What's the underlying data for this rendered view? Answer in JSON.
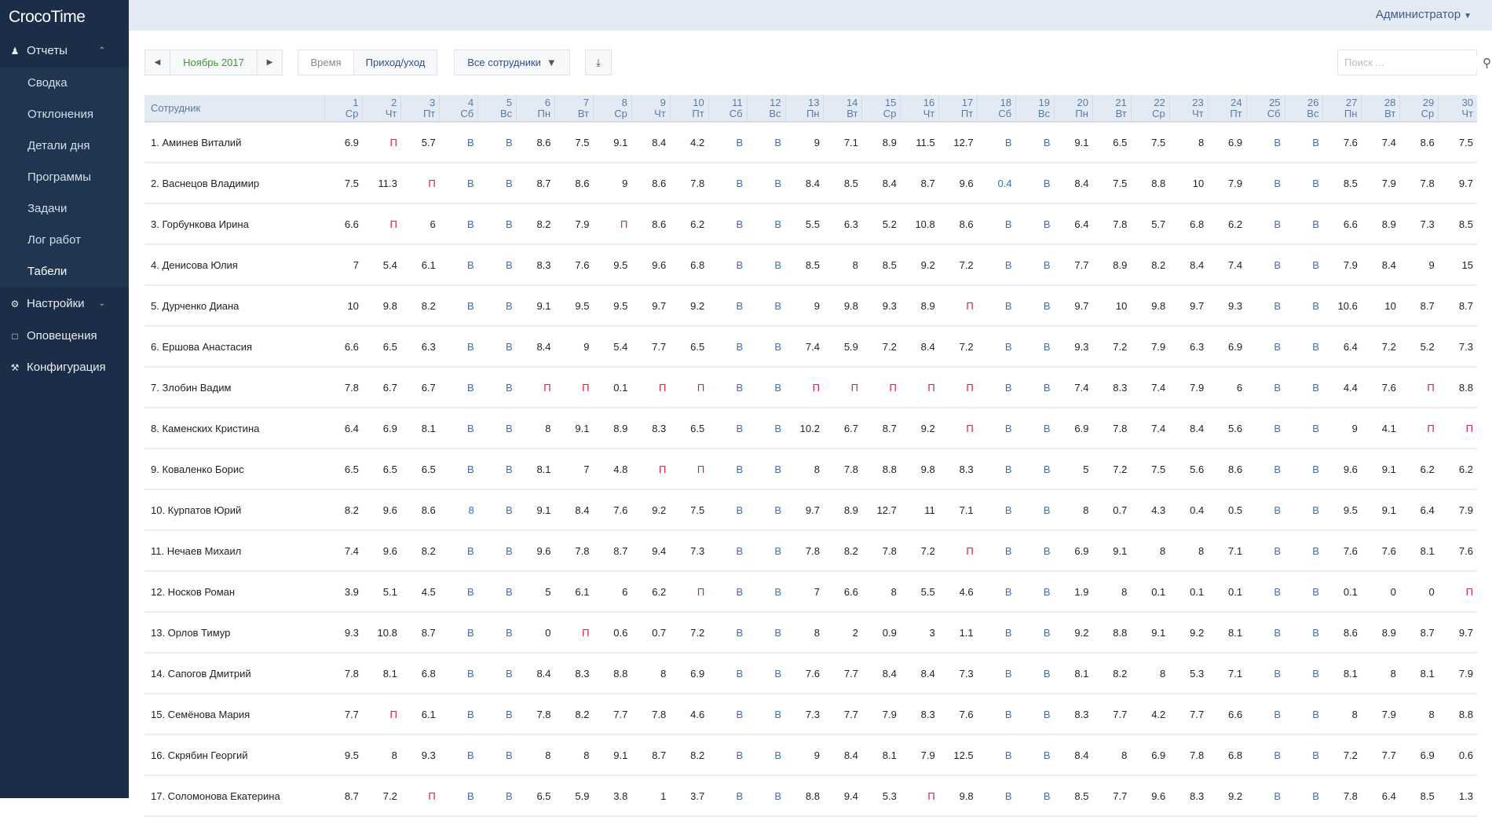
{
  "app": {
    "title": "CrocoTime"
  },
  "sidebar": {
    "reports": {
      "label": "Отчеты",
      "items": [
        "Сводка",
        "Отклонения",
        "Детали дня",
        "Программы",
        "Задачи",
        "Лог работ",
        "Табели"
      ],
      "active": "Табели"
    },
    "settings": "Настройки",
    "notifications": "Оповещения",
    "config": "Конфигурация"
  },
  "header": {
    "user": "Администратор"
  },
  "toolbar": {
    "month": "Ноябрь 2017",
    "mode_time": "Время",
    "mode_inout": "Приход/уход",
    "employees_filter": "Все сотрудники",
    "search_placeholder": "Поиск ..."
  },
  "colors": {
    "weekend": "#2f6fd0",
    "absence": "#e8163a",
    "month": "#3c9a2a",
    "sidebar": "#1c2e47"
  },
  "table": {
    "name_header": "Сотрудник",
    "weekdays": [
      "Ср",
      "Чт",
      "Пт",
      "Сб",
      "Вс",
      "Пн",
      "Вт",
      "Ср",
      "Чт",
      "Пт",
      "Сб",
      "Вс",
      "Пн",
      "Вт",
      "Ср",
      "Чт",
      "Пт",
      "Сб",
      "Вс",
      "Пн",
      "Вт",
      "Ср",
      "Чт",
      "Пт",
      "Сб",
      "Вс",
      "Пн",
      "Вт",
      "Ср",
      "Чт"
    ],
    "rows": [
      {
        "name": "1. Аминев Виталий",
        "v": [
          "6.9",
          "П",
          "5.7",
          "В",
          "В",
          "8.6",
          "7.5",
          "9.1",
          "8.4",
          "4.2",
          "В",
          "В",
          "9",
          "7.1",
          "8.9",
          "11.5",
          "12.7",
          "В",
          "В",
          "9.1",
          "6.5",
          "7.5",
          "8",
          "6.9",
          "В",
          "В",
          "7.6",
          "7.4",
          "8.6",
          "7.5"
        ]
      },
      {
        "name": "2. Васнецов Владимир",
        "v": [
          "7.5",
          "11.3",
          "П",
          "В",
          "В",
          "8.7",
          "8.6",
          "9",
          "8.6",
          "7.8",
          "В",
          "В",
          "8.4",
          "8.5",
          "8.4",
          "8.7",
          "9.6",
          "0.4",
          "В",
          "8.4",
          "7.5",
          "8.8",
          "10",
          "7.9",
          "В",
          "В",
          "8.5",
          "7.9",
          "7.8",
          "9.7"
        ]
      },
      {
        "name": "3. Горбункова Ирина",
        "v": [
          "6.6",
          "П",
          "6",
          "В",
          "В",
          "8.2",
          "7.9",
          "П",
          "8.6",
          "6.2",
          "В",
          "В",
          "5.5",
          "6.3",
          "5.2",
          "10.8",
          "8.6",
          "В",
          "В",
          "6.4",
          "7.8",
          "5.7",
          "6.8",
          "6.2",
          "В",
          "В",
          "6.6",
          "8.9",
          "7.3",
          "8.5"
        ]
      },
      {
        "name": "4. Денисова Юлия",
        "v": [
          "7",
          "5.4",
          "6.1",
          "В",
          "В",
          "8.3",
          "7.6",
          "9.5",
          "9.6",
          "6.8",
          "В",
          "В",
          "8.5",
          "8",
          "8.5",
          "9.2",
          "7.2",
          "В",
          "В",
          "7.7",
          "8.9",
          "8.2",
          "8.4",
          "7.4",
          "В",
          "В",
          "7.9",
          "8.4",
          "9",
          "15"
        ]
      },
      {
        "name": "5. Дурченко Диана",
        "v": [
          "10",
          "9.8",
          "8.2",
          "В",
          "В",
          "9.1",
          "9.5",
          "9.5",
          "9.7",
          "9.2",
          "В",
          "В",
          "9",
          "9.8",
          "9.3",
          "8.9",
          "П",
          "В",
          "В",
          "9.7",
          "10",
          "9.8",
          "9.7",
          "9.3",
          "В",
          "В",
          "10.6",
          "10",
          "8.7",
          "8.7"
        ]
      },
      {
        "name": "6. Ершова Анастасия",
        "v": [
          "6.6",
          "6.5",
          "6.3",
          "В",
          "В",
          "8.4",
          "9",
          "5.4",
          "7.7",
          "6.5",
          "В",
          "В",
          "7.4",
          "5.9",
          "7.2",
          "8.4",
          "7.2",
          "В",
          "В",
          "9.3",
          "7.2",
          "7.9",
          "6.3",
          "6.9",
          "В",
          "В",
          "6.4",
          "7.2",
          "5.2",
          "7.3"
        ]
      },
      {
        "name": "7. Злобин Вадим",
        "v": [
          "7.8",
          "6.7",
          "6.7",
          "В",
          "В",
          "П",
          "П",
          "0.1",
          "П",
          "П",
          "В",
          "В",
          "П",
          "П",
          "П",
          "П",
          "П",
          "В",
          "В",
          "7.4",
          "8.3",
          "7.4",
          "7.9",
          "6",
          "В",
          "В",
          "4.4",
          "7.6",
          "П",
          "8.8"
        ]
      },
      {
        "name": "8. Каменских Кристина",
        "v": [
          "6.4",
          "6.9",
          "8.1",
          "В",
          "В",
          "8",
          "9.1",
          "8.9",
          "8.3",
          "6.5",
          "В",
          "В",
          "10.2",
          "6.7",
          "8.7",
          "9.2",
          "П",
          "В",
          "В",
          "6.9",
          "7.8",
          "7.4",
          "8.4",
          "5.6",
          "В",
          "В",
          "9",
          "4.1",
          "П",
          "П"
        ]
      },
      {
        "name": "9. Коваленко Борис",
        "v": [
          "6.5",
          "6.5",
          "6.5",
          "В",
          "В",
          "8.1",
          "7",
          "4.8",
          "П",
          "П",
          "В",
          "В",
          "8",
          "7.8",
          "8.8",
          "9.8",
          "8.3",
          "В",
          "В",
          "5",
          "7.2",
          "7.5",
          "5.6",
          "8.6",
          "В",
          "В",
          "9.6",
          "9.1",
          "6.2",
          "6.2"
        ]
      },
      {
        "name": "10. Курпатов Юрий",
        "v": [
          "8.2",
          "9.6",
          "8.6",
          "8",
          "В",
          "9.1",
          "8.4",
          "7.6",
          "9.2",
          "7.5",
          "В",
          "В",
          "9.7",
          "8.9",
          "12.7",
          "11",
          "7.1",
          "В",
          "В",
          "8",
          "0.7",
          "4.3",
          "0.4",
          "0.5",
          "В",
          "В",
          "9.5",
          "9.1",
          "6.4",
          "7.9"
        ]
      },
      {
        "name": "11. Нечаев Михаил",
        "v": [
          "7.4",
          "9.6",
          "8.2",
          "В",
          "В",
          "9.6",
          "7.8",
          "8.7",
          "9.4",
          "7.3",
          "В",
          "В",
          "7.8",
          "8.2",
          "7.8",
          "7.2",
          "П",
          "В",
          "В",
          "6.9",
          "9.1",
          "8",
          "8",
          "7.1",
          "В",
          "В",
          "7.6",
          "7.6",
          "8.1",
          "7.6"
        ]
      },
      {
        "name": "12. Носков Роман",
        "v": [
          "3.9",
          "5.1",
          "4.5",
          "В",
          "В",
          "5",
          "6.1",
          "6",
          "6.2",
          "П",
          "В",
          "В",
          "7",
          "6.6",
          "8",
          "5.5",
          "4.6",
          "В",
          "В",
          "1.9",
          "8",
          "0.1",
          "0.1",
          "0.1",
          "В",
          "В",
          "0.1",
          "0",
          "0",
          "П"
        ]
      },
      {
        "name": "13. Орлов Тимур",
        "v": [
          "9.3",
          "10.8",
          "8.7",
          "В",
          "В",
          "0",
          "П",
          "0.6",
          "0.7",
          "7.2",
          "В",
          "В",
          "8",
          "2",
          "0.9",
          "3",
          "1.1",
          "В",
          "В",
          "9.2",
          "8.8",
          "9.1",
          "9.2",
          "8.1",
          "В",
          "В",
          "8.6",
          "8.9",
          "8.7",
          "9.7"
        ]
      },
      {
        "name": "14. Сапогов Дмитрий",
        "v": [
          "7.8",
          "8.1",
          "6.8",
          "В",
          "В",
          "8.4",
          "8.3",
          "8.8",
          "8",
          "6.9",
          "В",
          "В",
          "7.6",
          "7.7",
          "8.4",
          "8.4",
          "7.3",
          "В",
          "В",
          "8.1",
          "8.2",
          "8",
          "5.3",
          "7.1",
          "В",
          "В",
          "8.1",
          "8",
          "8.1",
          "7.9"
        ]
      },
      {
        "name": "15. Семёнова Мария",
        "v": [
          "7.7",
          "П",
          "6.1",
          "В",
          "В",
          "7.8",
          "8.2",
          "7.7",
          "7.8",
          "4.6",
          "В",
          "В",
          "7.3",
          "7.7",
          "7.9",
          "8.3",
          "7.6",
          "В",
          "В",
          "8.3",
          "7.7",
          "4.2",
          "7.7",
          "6.6",
          "В",
          "В",
          "8",
          "7.9",
          "8",
          "8.8"
        ]
      },
      {
        "name": "16. Скрябин Георгий",
        "v": [
          "9.5",
          "8",
          "9.3",
          "В",
          "В",
          "8",
          "8",
          "9.1",
          "8.7",
          "8.2",
          "В",
          "В",
          "9",
          "8.4",
          "8.1",
          "7.9",
          "12.5",
          "В",
          "В",
          "8.4",
          "8",
          "6.9",
          "7.8",
          "6.8",
          "В",
          "В",
          "7.2",
          "7.7",
          "6.9",
          "0.6"
        ]
      },
      {
        "name": "17. Соломонова Екатерина",
        "v": [
          "8.7",
          "7.2",
          "П",
          "В",
          "В",
          "6.5",
          "5.9",
          "3.8",
          "1",
          "3.7",
          "В",
          "В",
          "8.8",
          "9.4",
          "5.3",
          "П",
          "9.8",
          "В",
          "В",
          "8.5",
          "7.7",
          "9.6",
          "8.3",
          "9.2",
          "В",
          "В",
          "7.8",
          "6.4",
          "8.5",
          "1.3"
        ]
      }
    ]
  }
}
